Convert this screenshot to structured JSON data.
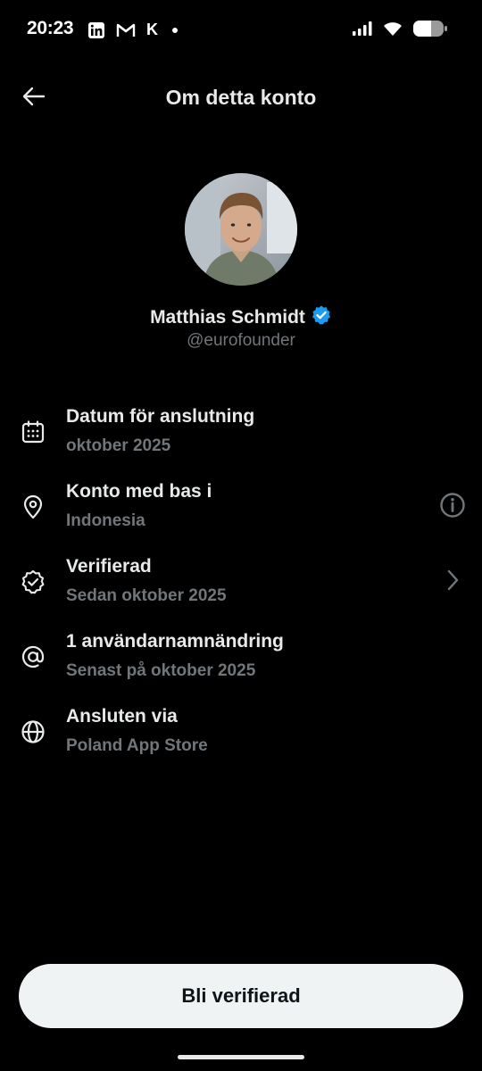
{
  "status_bar": {
    "time": "20:23",
    "apps": [
      "linkedin-icon",
      "gmail-icon",
      "klarna-icon",
      "notification-dot-icon"
    ],
    "app_k_label": "K",
    "right_icons": [
      "signal-icon",
      "wifi-icon",
      "battery-icon"
    ]
  },
  "header": {
    "title": "Om detta konto",
    "back_icon": "arrow-left-icon"
  },
  "profile": {
    "name": "Matthias Schmidt",
    "handle": "@eurofounder",
    "verified_badge_color": "#1d9bf0"
  },
  "info": [
    {
      "icon": "calendar-icon",
      "title": "Datum för anslutning",
      "subtitle": "oktober 2025",
      "action": null
    },
    {
      "icon": "location-pin-icon",
      "title": "Konto med bas i",
      "subtitle": "Indonesia",
      "action": "info-icon"
    },
    {
      "icon": "verified-check-icon",
      "title": "Verifierad",
      "subtitle": "Sedan oktober 2025",
      "action": "chevron-right-icon"
    },
    {
      "icon": "at-sign-icon",
      "title": "1 användarnamnändring",
      "subtitle": "Senast på oktober 2025",
      "action": null
    },
    {
      "icon": "globe-icon",
      "title": "Ansluten via",
      "subtitle": "Poland App Store",
      "action": null
    }
  ],
  "cta": {
    "label": "Bli verifierad"
  },
  "colors": {
    "background": "#000000",
    "primary_text": "#e7e9ea",
    "secondary_text": "#71767b",
    "button_bg": "#eff3f4",
    "button_text": "#0f1419",
    "accent": "#1d9bf0"
  }
}
